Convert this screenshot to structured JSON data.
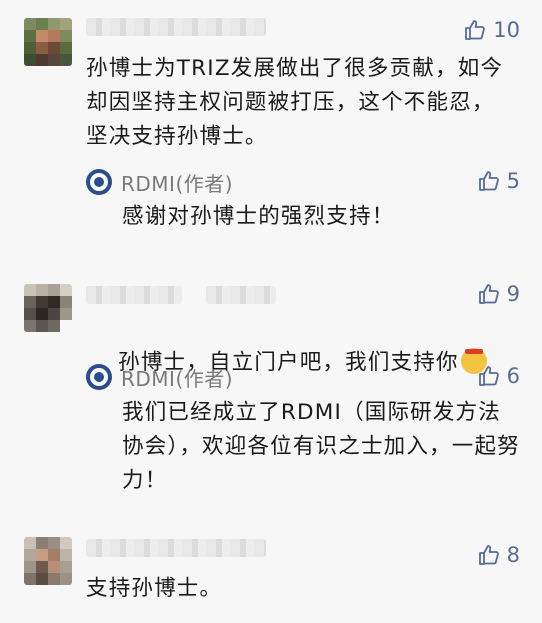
{
  "comments": [
    {
      "likes": "10",
      "text": "孙博士为TRIZ发展做出了很多贡献，如今却因坚持主权问题被打压，这个不能忍，坚决支持孙博士。",
      "reply": {
        "author": "RDMI(作者)",
        "likes": "5",
        "text": "感谢对孙博士的强烈支持！"
      }
    },
    {
      "likes": "9",
      "text": "孙博士，自立门户吧，我们支持你",
      "emoji": "shh-emoji",
      "reply": {
        "author": "RDMI(作者)",
        "likes": "6",
        "text": "我们已经成立了RDMI（国际研发方法协会），欢迎各位有识之士加入，一起努力！"
      }
    },
    {
      "likes": "8",
      "text": "支持孙博士。"
    }
  ],
  "colors": {
    "background": "#f7f7f7",
    "like_blue": "#576b95",
    "author_gray": "#7a7a7a",
    "logo_blue": "#2b4d8f"
  },
  "icons": {
    "like": "thumbs-up-icon",
    "author_logo": "rdmi-logo-icon"
  }
}
